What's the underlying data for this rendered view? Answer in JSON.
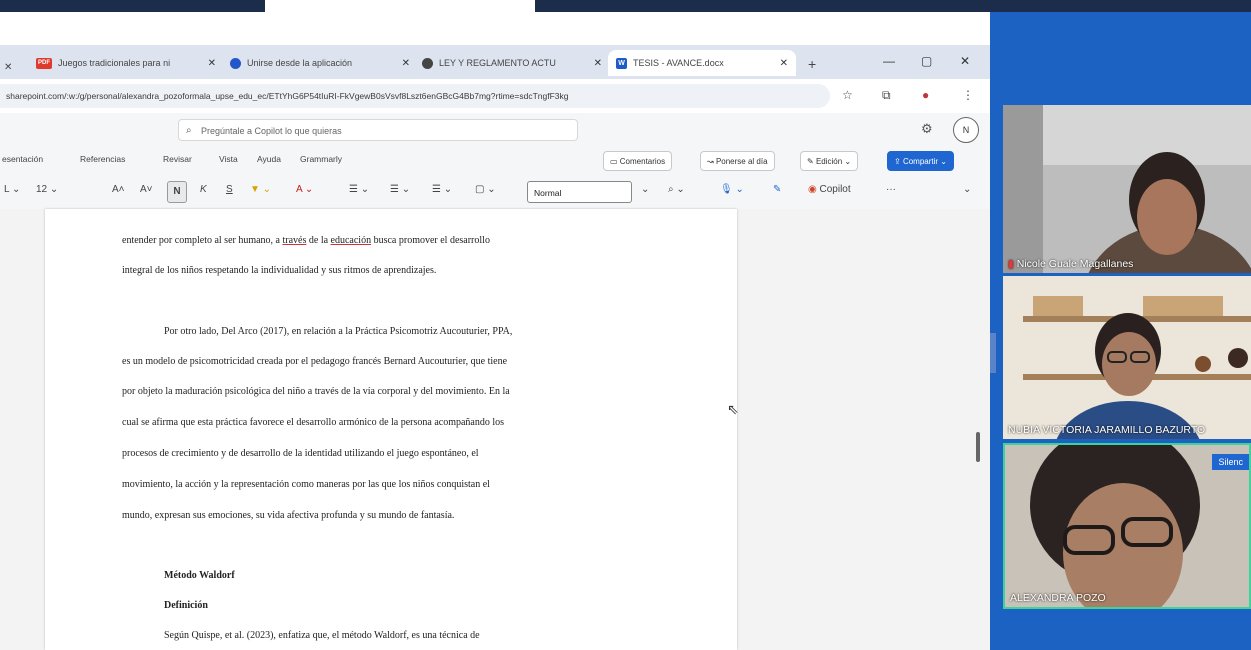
{
  "tabs": [
    {
      "label": "Juegos tradicionales para ni",
      "favicon": "pdf-icon",
      "fav_text": "PDF",
      "fav_color": "#e03a2f"
    },
    {
      "label": "Unirse desde la aplicación",
      "favicon": "teams-icon",
      "fav_text": "",
      "fav_color": "#2456c9"
    },
    {
      "label": "LEY Y REGLAMENTO ACTU",
      "favicon": "globe-icon",
      "fav_text": "",
      "fav_color": "#444444"
    },
    {
      "label": "TESIS - AVANCE.docx",
      "favicon": "word-icon",
      "fav_text": "W",
      "fav_color": "#1e5bc6"
    }
  ],
  "new_tab": "+",
  "window_controls": {
    "minimize": "—",
    "restore": "▢",
    "close": "✕"
  },
  "url": "sharepoint.com/:w:/g/personal/alexandra_pozoformala_upse_edu_ec/ETtYhG6P54tIuRI-FkVgewB0sVsvf8Lszt6enGBcG4Bb7mg?rtime=sdcTngfF3kg",
  "app": {
    "copilot_placeholder": "Pregúntale a Copilot lo que quieras",
    "user_initial": "N"
  },
  "menu": {
    "items": [
      "esentación",
      "Referencias",
      "Revisar",
      "Vista",
      "Ayuda",
      "Grammarly"
    ],
    "comments": "Comentarios",
    "catchup": "Ponerse al día",
    "editing": "Edición",
    "share": "Compartir"
  },
  "toolbar": {
    "font_size": "12",
    "bold": "N",
    "italic": "K",
    "underline": "S",
    "style": "Normal",
    "copilot": "Copilot",
    "more": "···"
  },
  "document": {
    "lines": [
      {
        "pre": "entender por completo al ser humano, a ",
        "u1": "través",
        "mid": " de la ",
        "u2": "educación",
        "post": " busca promover el desarrollo"
      },
      {
        "text": "integral de los niños respetando la individualidad y sus ritmos de aprendizajes."
      },
      {
        "text": "Por otro lado, Del Arco (2017), en relación a la Práctica Psicomotriz Aucouturier, PPA,"
      },
      {
        "text": "es un modelo de psicomotricidad creada por el pedagogo francés Bernard Aucouturier, que tiene"
      },
      {
        "text": "por objeto la maduración psicológica del niño a través de la vía corporal y del movimiento. En la"
      },
      {
        "text": "cual se afirma que esta práctica favorece el desarrollo armónico de la persona acompañando los"
      },
      {
        "text": "procesos de crecimiento y de desarrollo de la identidad utilizando el juego espontáneo, el"
      },
      {
        "text": "movimiento, la acción y la representación como maneras por las que los niños conquistan el"
      },
      {
        "text": "mundo, expresan sus emociones, su vida afectiva profunda y su mundo de fantasía."
      }
    ],
    "heading1": "Método Waldorf",
    "heading2": "Definición",
    "last_line": "Según Quispe, et al. (2023), enfatiza que, el método Waldorf, es una técnica de"
  },
  "participants": [
    {
      "name": "Nicole Guale Magallanes"
    },
    {
      "name": "NUBIA VICTORIA JARAMILLO BAZURTO"
    },
    {
      "name": "ALEXANDRA POZO",
      "badge": "Silenc"
    }
  ]
}
